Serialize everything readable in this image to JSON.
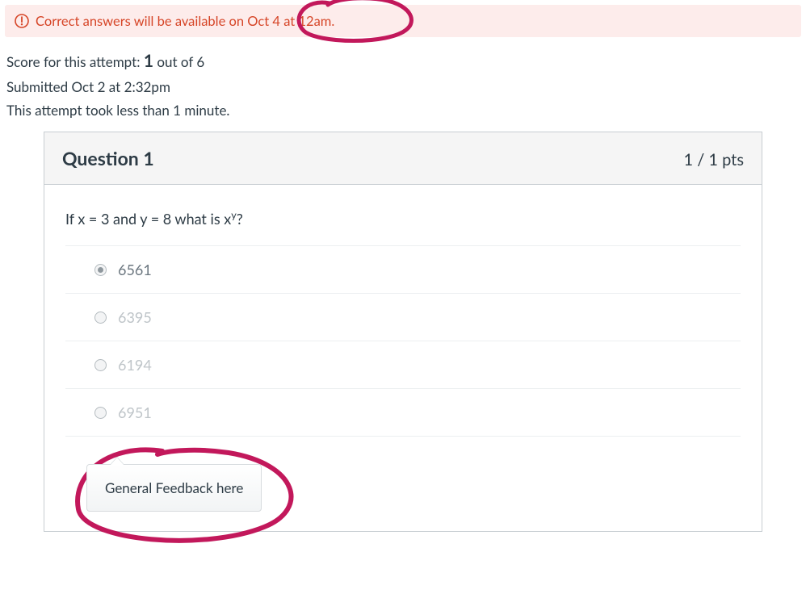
{
  "alert": {
    "text": "Correct answers will be available on Oct 4 at 12am."
  },
  "attempt": {
    "score_label_prefix": "Score for this attempt: ",
    "score_earned": "1",
    "score_label_suffix": " out of 6",
    "submitted_line": "Submitted Oct 2 at 2:32pm",
    "duration_line": "This attempt took less than 1 minute."
  },
  "question": {
    "title": "Question 1",
    "points": "1 / 1 pts",
    "prompt_prefix": "If x = 3 and y = 8 what is x",
    "prompt_sup": "y",
    "prompt_suffix": "?",
    "answers": [
      {
        "label": "6561",
        "selected": true
      },
      {
        "label": "6395",
        "selected": false
      },
      {
        "label": "6194",
        "selected": false
      },
      {
        "label": "6951",
        "selected": false
      }
    ],
    "feedback": "General Feedback here"
  },
  "annotation_color": "#c2185b"
}
